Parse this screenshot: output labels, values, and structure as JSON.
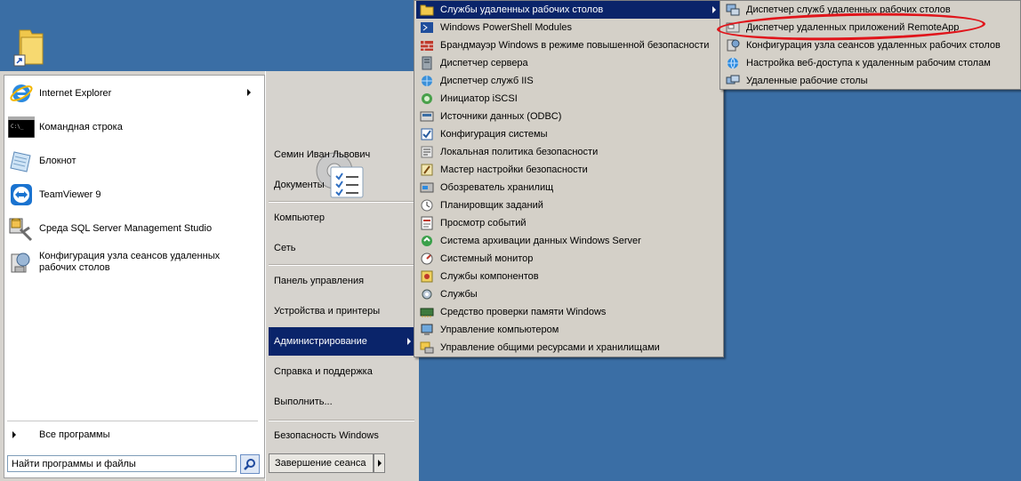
{
  "start_menu": {
    "programs": [
      {
        "label": "Internet Explorer",
        "icon": "internet-explorer-icon",
        "has_submenu": true
      },
      {
        "label": "Командная строка",
        "icon": "command-prompt-icon"
      },
      {
        "label": "Блокнот",
        "icon": "notepad-icon"
      },
      {
        "label": "TeamViewer 9",
        "icon": "teamviewer-icon"
      },
      {
        "label": "Среда SQL Server Management Studio",
        "icon": "sql-management-studio-icon"
      },
      {
        "label": "Конфигурация узла сеансов удаленных рабочих столов",
        "icon": "rds-host-config-icon"
      }
    ],
    "all_programs_label": "Все программы",
    "search_placeholder": "Найти программы и файлы",
    "right_items": [
      {
        "label": "Семин Иван Львович"
      },
      {
        "label": "Документы"
      },
      {
        "label": "Компьютер"
      },
      {
        "label": "Сеть"
      },
      {
        "label": "Панель управления"
      },
      {
        "label": "Устройства и принтеры"
      },
      {
        "label": "Администрирование",
        "selected": true,
        "has_submenu": true
      },
      {
        "label": "Справка и поддержка"
      },
      {
        "label": "Выполнить..."
      },
      {
        "label": "Безопасность Windows"
      }
    ],
    "shutdown_label": "Завершение сеанса"
  },
  "admin_submenu": [
    {
      "label": "Службы удаленных рабочих столов",
      "icon": "folder-icon",
      "selected": true,
      "has_submenu": true
    },
    {
      "label": "Windows PowerShell Modules",
      "icon": "powershell-icon"
    },
    {
      "label": "Брандмауэр Windows в режиме повышенной безопасности",
      "icon": "firewall-icon"
    },
    {
      "label": "Диспетчер сервера",
      "icon": "server-manager-icon"
    },
    {
      "label": "Диспетчер служб IIS",
      "icon": "iis-icon"
    },
    {
      "label": "Инициатор iSCSI",
      "icon": "iscsi-icon"
    },
    {
      "label": "Источники данных (ODBC)",
      "icon": "odbc-icon"
    },
    {
      "label": "Конфигурация системы",
      "icon": "msconfig-icon"
    },
    {
      "label": "Локальная политика безопасности",
      "icon": "security-policy-icon"
    },
    {
      "label": "Мастер настройки безопасности",
      "icon": "security-wizard-icon"
    },
    {
      "label": "Обозреватель хранилищ",
      "icon": "storage-explorer-icon"
    },
    {
      "label": "Планировщик заданий",
      "icon": "task-scheduler-icon"
    },
    {
      "label": "Просмотр событий",
      "icon": "event-viewer-icon"
    },
    {
      "label": "Система архивации данных Windows Server",
      "icon": "backup-icon"
    },
    {
      "label": "Системный монитор",
      "icon": "perfmon-icon"
    },
    {
      "label": "Службы компонентов",
      "icon": "component-services-icon"
    },
    {
      "label": "Службы",
      "icon": "services-icon"
    },
    {
      "label": "Средство проверки памяти Windows",
      "icon": "memory-diagnostic-icon"
    },
    {
      "label": "Управление компьютером",
      "icon": "computer-management-icon"
    },
    {
      "label": "Управление общими ресурсами и хранилищами",
      "icon": "share-storage-icon"
    }
  ],
  "rds_submenu": [
    {
      "label": "Диспетчер служб удаленных рабочих столов",
      "icon": "rds-manager-icon"
    },
    {
      "label": "Диспетчер удаленных приложений RemoteApp",
      "icon": "remoteapp-icon",
      "highlighted_annotation": true
    },
    {
      "label": "Конфигурация узла сеансов удаленных рабочих столов",
      "icon": "rds-host-config-icon"
    },
    {
      "label": "Настройка веб-доступа к удаленным рабочим столам",
      "icon": "rd-web-access-icon"
    },
    {
      "label": "Удаленные рабочие столы",
      "icon": "remote-desktops-icon"
    }
  ],
  "colors": {
    "desktop": "#3a6ea5",
    "selection": "#0a246a",
    "annotation": "#e0151b"
  }
}
